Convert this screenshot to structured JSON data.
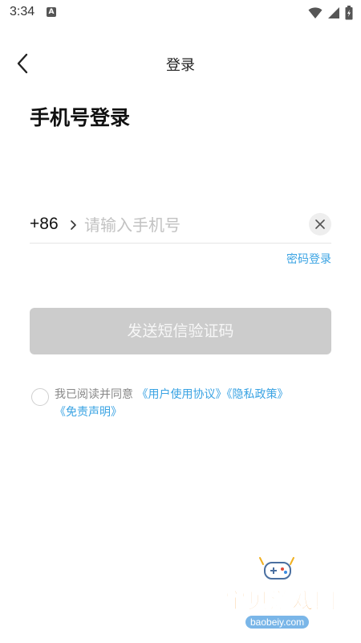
{
  "status_bar": {
    "time": "3:34",
    "notification_icon": "A",
    "icons": [
      "wifi-icon",
      "signal-icon",
      "battery-icon"
    ]
  },
  "nav": {
    "back_icon": "chevron-left-icon",
    "title": "登录"
  },
  "page_title": "手机号登录",
  "phone": {
    "country_code": "+86",
    "placeholder": "请输入手机号",
    "value": "",
    "clear_icon": "clear-icon"
  },
  "password_login_link": "密码登录",
  "send_code_button": "发送短信验证码",
  "agreement": {
    "prefix": "我已阅读并同意",
    "user_agreement": "《用户使用协议》",
    "privacy_policy": "《隐私政策》",
    "disclaimer": "《免责声明》"
  },
  "watermark": {
    "site_name": "宝贝游戏网",
    "url": "baobeiy.com"
  },
  "colors": {
    "link": "#3aa3e3",
    "button_disabled": "#cccccc",
    "watermark_orange": "#f08a14"
  }
}
